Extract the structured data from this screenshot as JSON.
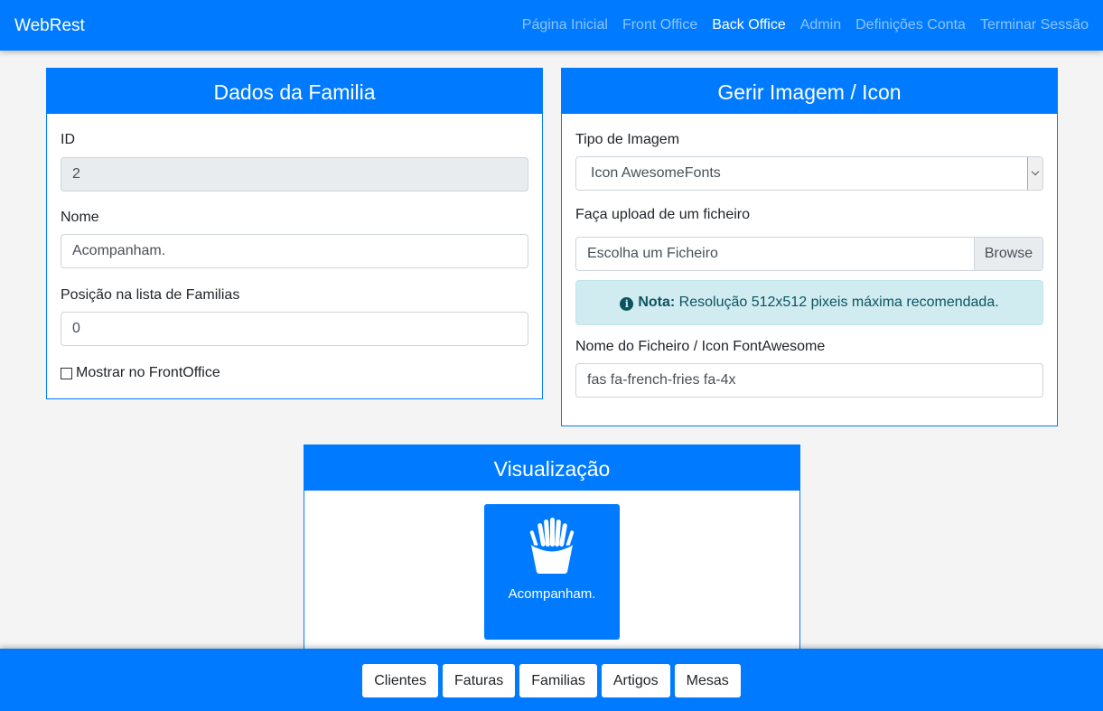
{
  "navbar": {
    "brand": "WebRest",
    "links": [
      "Página Inicial",
      "Front Office",
      "Back Office",
      "Admin",
      "Definições Conta",
      "Terminar Sessão"
    ],
    "active": "Back Office"
  },
  "family_card": {
    "title": "Dados da Familia",
    "id_label": "ID",
    "id_value": "2",
    "name_label": "Nome",
    "name_value": "Acompanham.",
    "position_label": "Posição na lista de Familias",
    "position_value": "0",
    "show_frontoffice_label": "Mostrar no FrontOffice",
    "show_frontoffice_checked": false
  },
  "image_card": {
    "title": "Gerir Imagem / Icon",
    "type_label": "Tipo de Imagem",
    "type_value": "Icon AwesomeFonts",
    "upload_label": "Faça upload de um ficheiro",
    "upload_placeholder": "Escolha um Ficheiro",
    "browse_label": "Browse",
    "note_label": "Nota:",
    "note_text": " Resolução 512x512 pixeis máxima recomendada.",
    "filename_label": "Nome do Ficheiro / Icon FontAwesome",
    "filename_value": "fas fa-french-fries fa-4x"
  },
  "preview_card": {
    "title": "Visualização",
    "tile_label": "Acompanham.",
    "tile_icon": "french-fries-icon"
  },
  "footer": {
    "buttons": [
      "Clientes",
      "Faturas",
      "Familias",
      "Artigos",
      "Mesas"
    ]
  },
  "colors": {
    "primary": "#007bff",
    "info_bg": "#d1ecf1",
    "info_text": "#0c5460"
  }
}
